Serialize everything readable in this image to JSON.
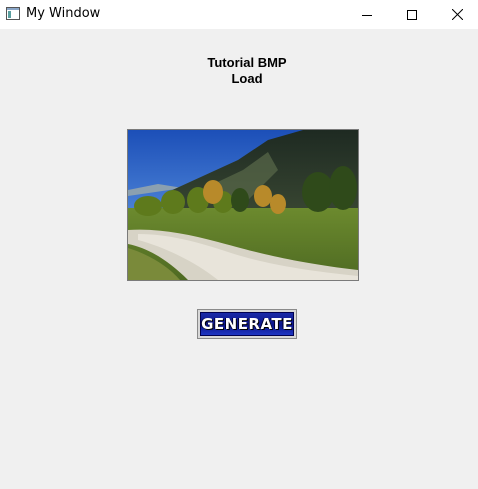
{
  "window": {
    "title": "My Window",
    "controls": {
      "minimize_icon": "minimize-icon",
      "maximize_icon": "maximize-icon",
      "close_icon": "close-icon"
    }
  },
  "header": {
    "line1": "Tutorial BMP",
    "line2": "Load"
  },
  "image": {
    "subject": "mountain landscape photo"
  },
  "button": {
    "label": "GENERATE",
    "color": "#1528b0"
  }
}
